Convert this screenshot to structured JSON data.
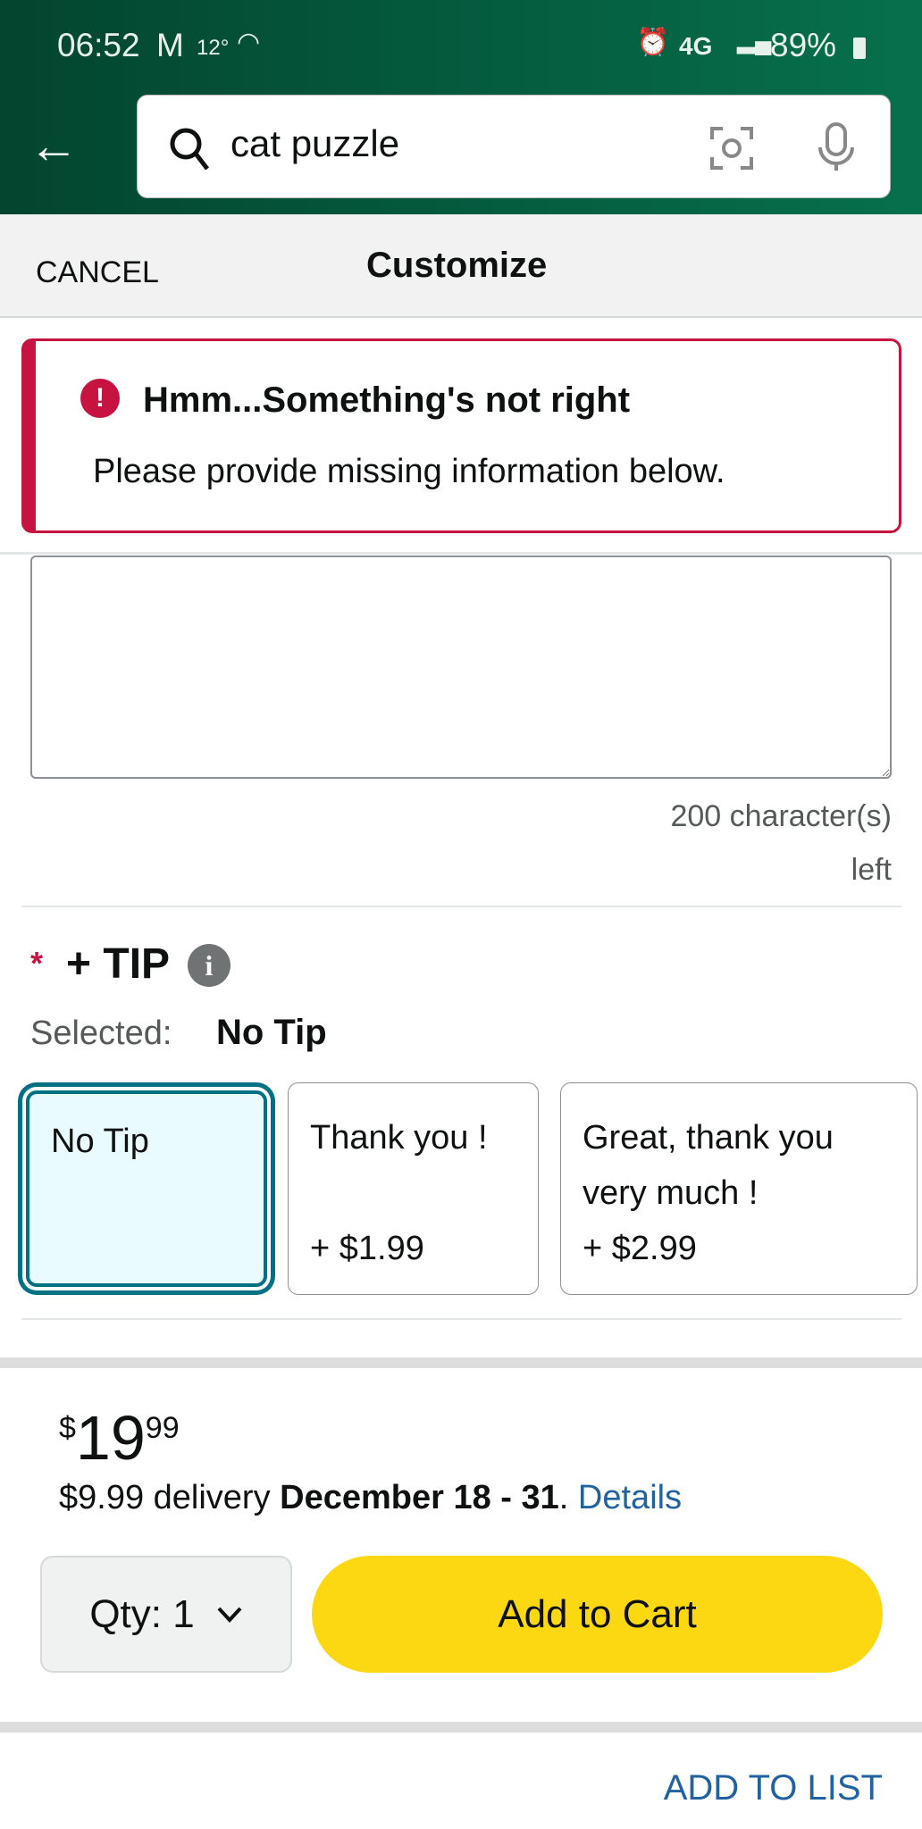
{
  "status_bar": {
    "time": "06:52",
    "temp": "12°",
    "network": "4G",
    "battery": "89%"
  },
  "search": {
    "query": "cat puzzle"
  },
  "nav": {
    "cancel": "CANCEL",
    "title": "Customize"
  },
  "error": {
    "title": "Hmm...Something's not right",
    "message": "Please provide missing information below."
  },
  "textarea": {
    "value": "",
    "counter_line1": "200 character(s)",
    "counter_line2": "left"
  },
  "tip": {
    "required_mark": "*",
    "label": "+ TIP",
    "selected_label": "Selected:",
    "selected_value": "No Tip",
    "options": [
      {
        "title": "No Tip",
        "price": ""
      },
      {
        "title": "Thank you !",
        "price": "+ $1.99"
      },
      {
        "title": "Great, thank you very much !",
        "price": "+ $2.99"
      }
    ]
  },
  "price": {
    "currency": "$",
    "whole": "19",
    "fraction": "99"
  },
  "delivery": {
    "text": "$9.99 delivery ",
    "date": "December 18 - 31",
    "period": ".",
    "details": "Details"
  },
  "qty": {
    "label": "Qty: 1"
  },
  "add_to_cart": "Add to Cart",
  "add_to_list": "ADD TO LIST",
  "colors": {
    "header": "#06704c",
    "error": "#c7133f",
    "accent": "#007185",
    "cart": "#fcd813",
    "link": "#2162a1"
  }
}
